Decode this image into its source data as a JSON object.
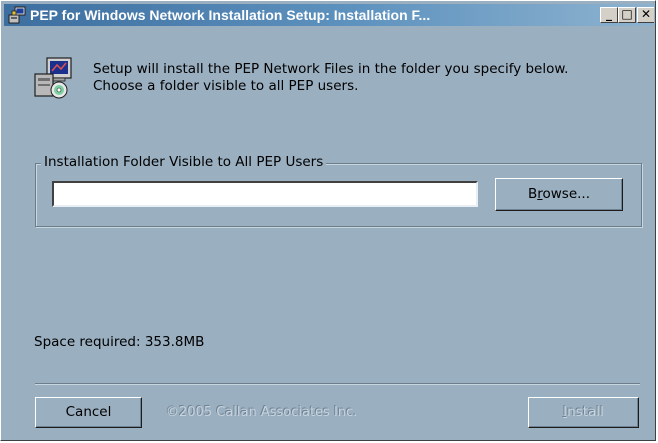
{
  "window": {
    "title": "PEP for Windows Network Installation Setup: Installation F...",
    "controls": {
      "minimize": "_",
      "maximize": "□",
      "close": "✕"
    }
  },
  "message": {
    "line1": "Setup will install the PEP Network Files in the folder you specify below.",
    "line2": "Choose a folder visible to all PEP users."
  },
  "folder_group": {
    "label": "Installation Folder Visible to All PEP Users",
    "input_value": "",
    "browse_pre": "B",
    "browse_hotkey": "r",
    "browse_post": "owse..."
  },
  "space_required": "Space required: 353.8MB",
  "footer": {
    "cancel_label": "Cancel",
    "copyright": "©2005 Callan Associates Inc.",
    "install_hotkey": "I",
    "install_post": "nstall",
    "install_enabled": false
  },
  "colors": {
    "window_bg": "#9aafc0",
    "titlebar_start": "#3c6e9f",
    "titlebar_end": "#8db2cf",
    "disabled_text": "#c7d4de"
  },
  "icons": {
    "title": "installer-icon",
    "message": "setup-computer-icon"
  }
}
